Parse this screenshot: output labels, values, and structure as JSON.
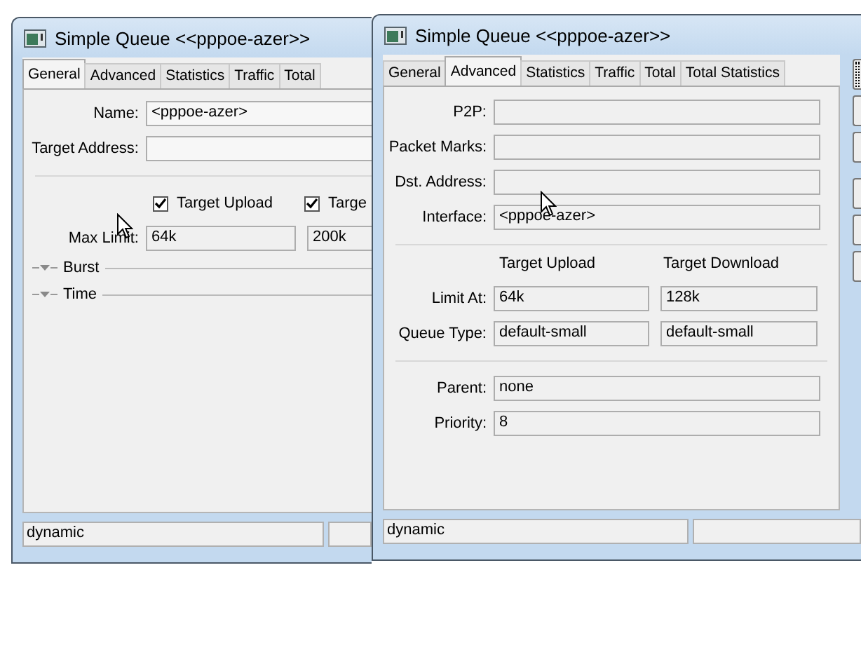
{
  "general_window": {
    "title": "Simple Queue <<pppoe-azer>>",
    "tabs": [
      {
        "label": "General",
        "selected": true
      },
      {
        "label": "Advanced",
        "selected": false
      },
      {
        "label": "Statistics",
        "selected": false
      },
      {
        "label": "Traffic",
        "selected": false
      },
      {
        "label": "Total",
        "selected": false
      }
    ],
    "fields": [
      {
        "label": "Name:",
        "value": "<pppoe-azer>"
      },
      {
        "label": "Target Address:"
      }
    ],
    "targets": [
      {
        "label": "Target Upload",
        "checked": true
      },
      {
        "label": "Targe",
        "checked": true
      }
    ],
    "max_limit": {
      "label": "Max Limit:",
      "values": [
        "64k",
        "200k"
      ]
    },
    "sections": [
      {
        "label": "Burst"
      },
      {
        "label": "Time"
      }
    ],
    "status_bar": {
      "text": "dynamic"
    }
  },
  "advanced_window": {
    "title": "Simple Queue <<pppoe-azer>>",
    "tabs": [
      {
        "label": "General",
        "selected": false
      },
      {
        "label": "Advanced",
        "selected": true
      },
      {
        "label": "Statistics",
        "selected": false
      },
      {
        "label": "Traffic",
        "selected": false
      },
      {
        "label": "Total",
        "selected": false
      },
      {
        "label": "Total Statistics",
        "selected": false
      }
    ],
    "fields": [
      {
        "label": "P2P:"
      },
      {
        "label": "Packet Marks:"
      },
      {
        "label": "Dst. Address:"
      },
      {
        "label": "Interface:",
        "value": "<pppoe-azer>"
      }
    ],
    "column_headers": [
      "Target Upload",
      "Target Download"
    ],
    "limit_rows": [
      {
        "label": "Limit At:",
        "values": [
          "64k",
          "128k"
        ]
      },
      {
        "label": "Queue Type:",
        "values": [
          "default-small",
          "default-small"
        ]
      }
    ],
    "parent_fields": [
      {
        "label": "Parent:",
        "value": "none"
      },
      {
        "label": "Priority:",
        "value": "8"
      }
    ],
    "status_bar": {
      "text": "dynamic"
    }
  }
}
